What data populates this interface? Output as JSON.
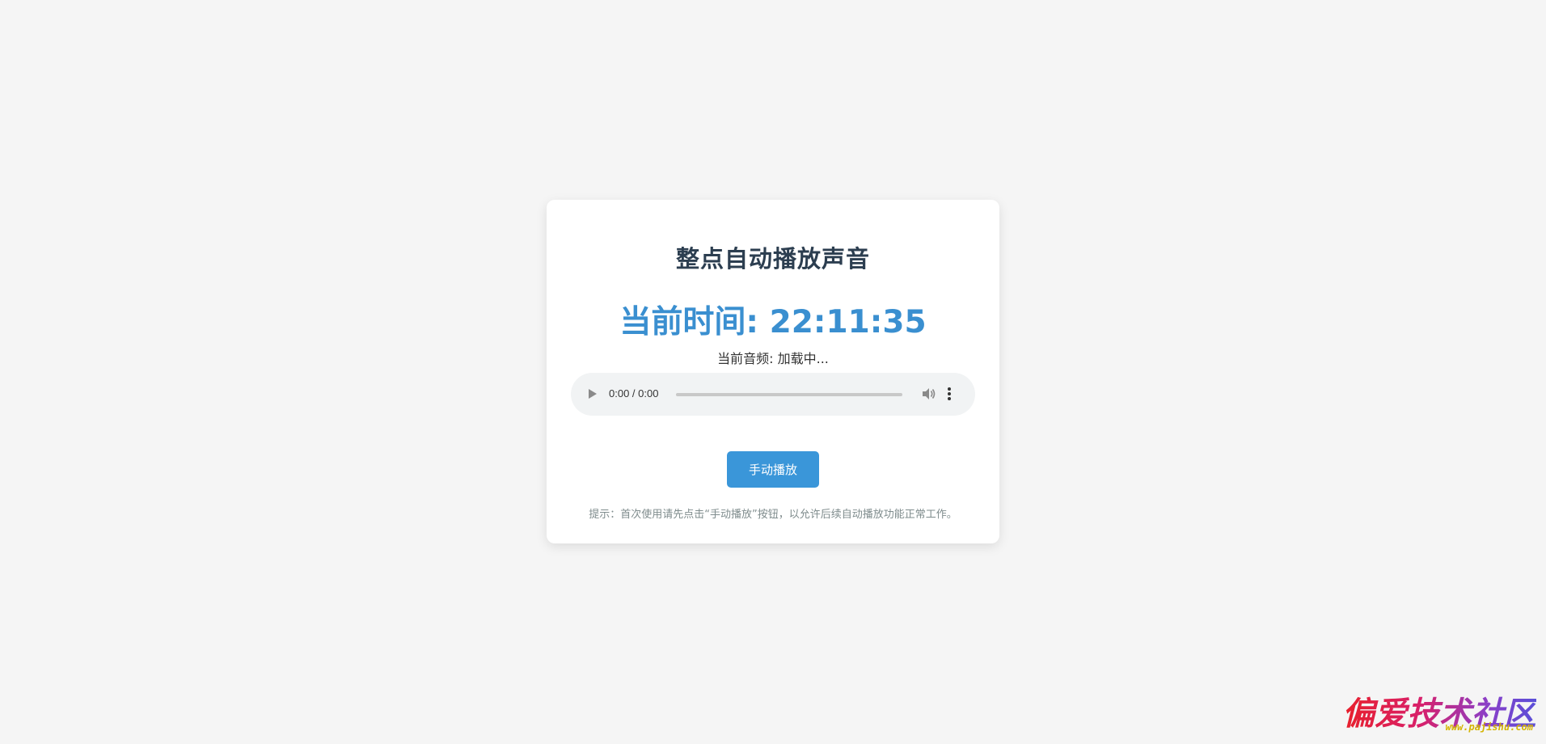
{
  "card": {
    "title": "整点自动播放声音",
    "clock_label": "当前时间: 22:11:35",
    "audio_label": "当前音频: 加载中...",
    "hint": "提示：首次使用请先点击“手动播放”按钮，以允许后续自动播放功能正常工作。"
  },
  "player": {
    "time": "0:00 / 0:00",
    "progress": 0,
    "icons": [
      "play-icon",
      "volume-icon",
      "more-vert-icon"
    ]
  },
  "button": {
    "label": "手动播放"
  },
  "watermark": {
    "text": "偏爱技术社区",
    "url": "www.pajishu.com"
  },
  "colors": {
    "background": "#f5f5f5",
    "card": "#ffffff",
    "title": "#2c3e50",
    "accent": "#3a96d9",
    "hint": "#7f8c8d"
  }
}
